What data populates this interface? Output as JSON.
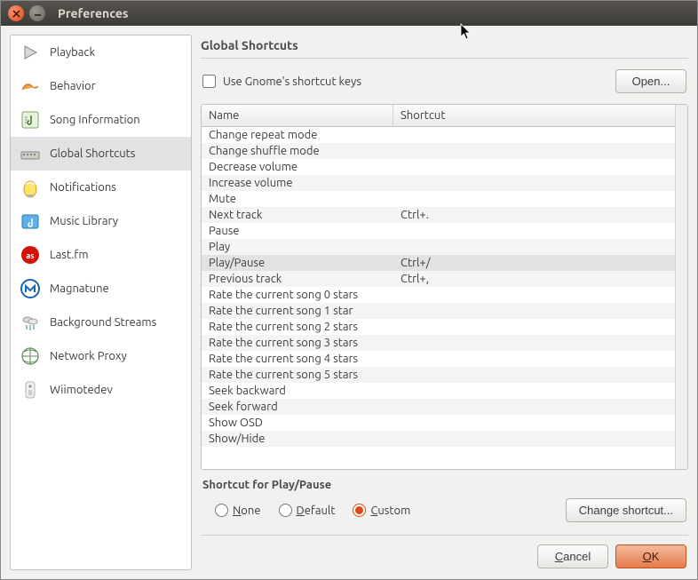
{
  "window_title": "Preferences",
  "sidebar": {
    "items": [
      {
        "label": "Playback"
      },
      {
        "label": "Behavior"
      },
      {
        "label": "Song Information"
      },
      {
        "label": "Global Shortcuts"
      },
      {
        "label": "Notifications"
      },
      {
        "label": "Music Library"
      },
      {
        "label": "Last.fm"
      },
      {
        "label": "Magnatune"
      },
      {
        "label": "Background Streams"
      },
      {
        "label": "Network Proxy"
      },
      {
        "label": "Wiimotedev"
      }
    ],
    "selected_index": 3
  },
  "main": {
    "heading": "Global Shortcuts",
    "use_gnome_label": "Use Gnome's shortcut keys",
    "use_gnome_checked": false,
    "open_button": "Open...",
    "columns": {
      "name": "Name",
      "shortcut": "Shortcut"
    },
    "rows": [
      {
        "name": "Change repeat mode",
        "shortcut": ""
      },
      {
        "name": "Change shuffle mode",
        "shortcut": ""
      },
      {
        "name": "Decrease volume",
        "shortcut": ""
      },
      {
        "name": "Increase volume",
        "shortcut": ""
      },
      {
        "name": "Mute",
        "shortcut": ""
      },
      {
        "name": "Next track",
        "shortcut": "Ctrl+."
      },
      {
        "name": "Pause",
        "shortcut": ""
      },
      {
        "name": "Play",
        "shortcut": ""
      },
      {
        "name": "Play/Pause",
        "shortcut": "Ctrl+/"
      },
      {
        "name": "Previous track",
        "shortcut": "Ctrl+,"
      },
      {
        "name": "Rate the current song 0 stars",
        "shortcut": ""
      },
      {
        "name": "Rate the current song 1 star",
        "shortcut": ""
      },
      {
        "name": "Rate the current song 2 stars",
        "shortcut": ""
      },
      {
        "name": "Rate the current song 3 stars",
        "shortcut": ""
      },
      {
        "name": "Rate the current song 4 stars",
        "shortcut": ""
      },
      {
        "name": "Rate the current song 5 stars",
        "shortcut": ""
      },
      {
        "name": "Seek backward",
        "shortcut": ""
      },
      {
        "name": "Seek forward",
        "shortcut": ""
      },
      {
        "name": "Show OSD",
        "shortcut": ""
      },
      {
        "name": "Show/Hide",
        "shortcut": ""
      }
    ],
    "selected_row_index": 8
  },
  "shortcut_for": {
    "label_prefix": "Shortcut for ",
    "target": "Play/Pause",
    "none_label": "None",
    "default_label": "Default",
    "custom_label": "Custom",
    "selected": "custom",
    "change_button": "Change shortcut..."
  },
  "footer": {
    "cancel_label": "Cancel",
    "ok_label": "OK"
  }
}
